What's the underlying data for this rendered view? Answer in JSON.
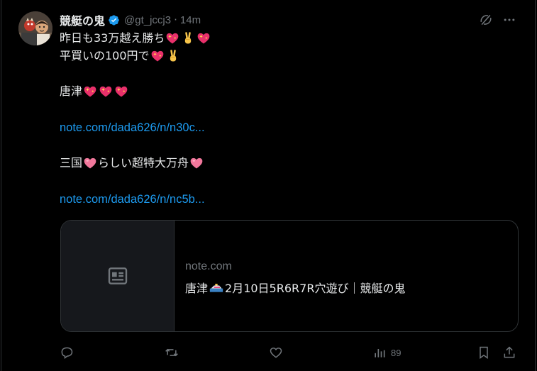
{
  "post": {
    "author_name": "競艇の鬼",
    "handle": "@gt_jccj3",
    "separator": "·",
    "time": "14m",
    "lines": {
      "l1": "昨日も33万越え勝ち",
      "l2": "平買いの100円で",
      "l3": "唐津",
      "link1": "note.com/dada626/n/n30c...",
      "l4a": "三国",
      "l4b": "らしい超特大万舟",
      "link2": "note.com/dada626/n/nc5b..."
    }
  },
  "card": {
    "domain": "note.com",
    "title_prefix": "唐津",
    "title_suffix": "2月10日5R6R7R穴遊び｜競艇の鬼"
  },
  "actions": {
    "views": "89"
  },
  "icons": {
    "verified": "verified-badge-icon",
    "grok": "grok-icon",
    "more": "more-icon",
    "reply": "reply-icon",
    "repost": "repost-icon",
    "like": "like-icon",
    "views": "views-icon",
    "bookmark": "bookmark-icon",
    "share": "share-icon",
    "article": "article-icon"
  },
  "colors": {
    "link": "#1d9bf0",
    "verified": "#1d9bf0",
    "muted": "#71767b",
    "text": "#e7e9ea",
    "background": "#000000"
  }
}
